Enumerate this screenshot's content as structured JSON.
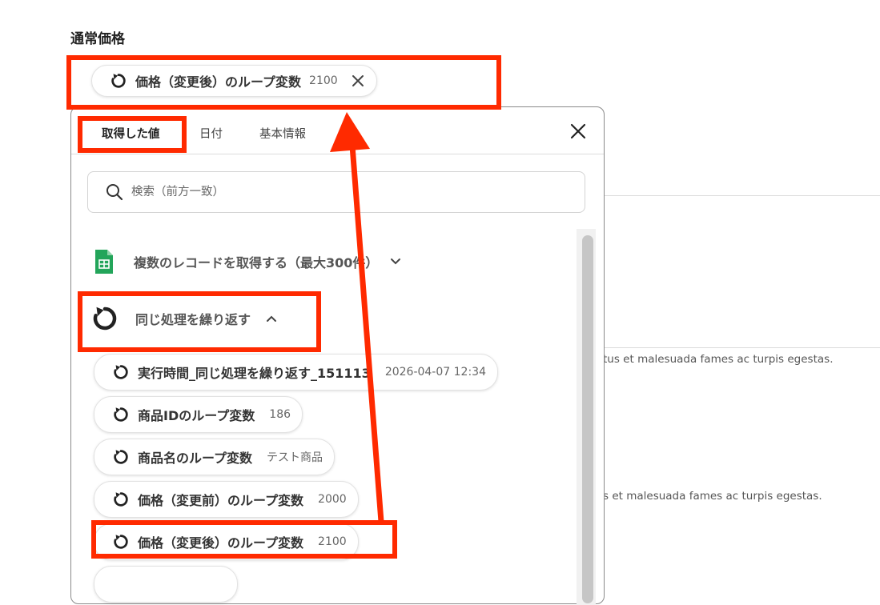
{
  "field": {
    "label": "通常価格",
    "selected": {
      "label": "価格（変更後）のループ変数",
      "value": "2100"
    }
  },
  "background": {
    "text1": "tus et malesuada fames ac turpis egestas.",
    "text2": "s et malesuada fames ac turpis egestas."
  },
  "popup": {
    "tabs": [
      "取得した値",
      "日付",
      "基本情報"
    ],
    "search_placeholder": "検索（前方一致）",
    "group_sheets": "複数のレコードを取得する（最大300件）",
    "group_loop": "同じ処理を繰り返す",
    "items": [
      {
        "label": "実行時間_同じ処理を繰り返す_151113",
        "value": "2026-04-07 12:34"
      },
      {
        "label": "商品IDのループ変数",
        "value": "186"
      },
      {
        "label": "商品名のループ変数",
        "value": "テスト商品"
      },
      {
        "label": "価格（変更前）のループ変数",
        "value": "2000"
      },
      {
        "label": "価格（変更後）のループ変数",
        "value": "2100"
      }
    ]
  },
  "colors": {
    "highlight": "#ff2a00",
    "sheets_green": "#23a55a"
  }
}
